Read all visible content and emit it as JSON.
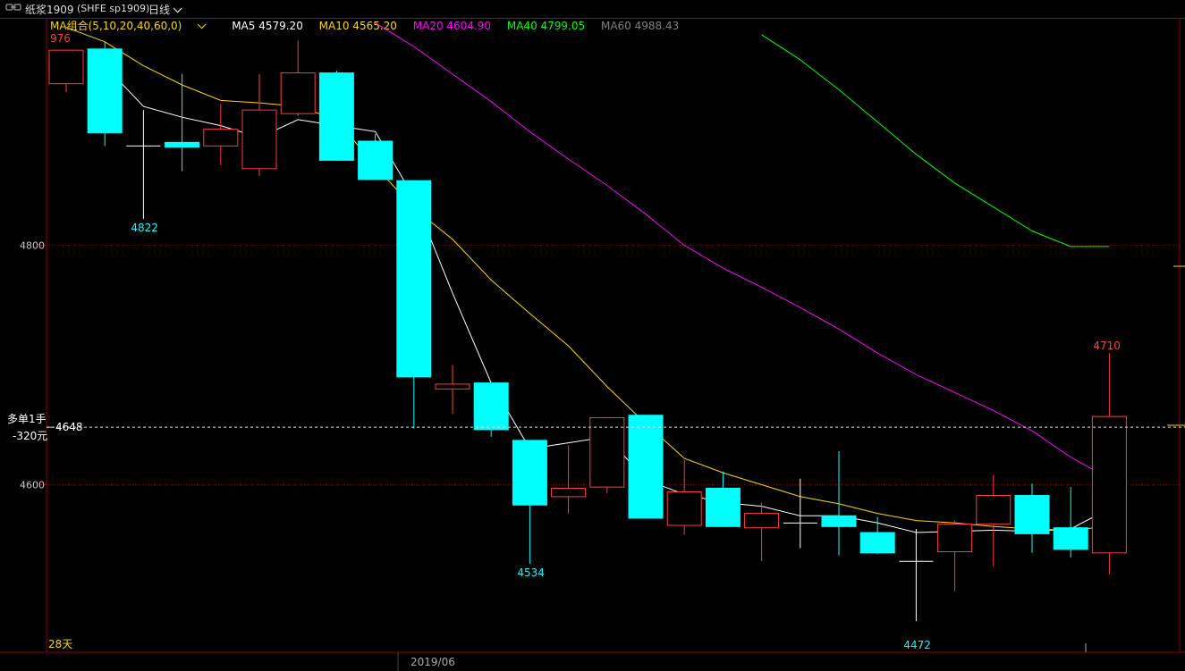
{
  "header": {
    "link_icon": "link-icon",
    "instrument": "纸浆1909",
    "code": "(SHFE sp1909)",
    "period": "日线"
  },
  "legend": {
    "group_label": "MA组合(5,10,20,40,60,0)",
    "items": [
      {
        "label": "MA5 4579.20",
        "color": "#ffffff"
      },
      {
        "label": "MA10 4565.20",
        "color": "#ffd700"
      },
      {
        "label": "MA20 4604.90",
        "color": "#ff00ff"
      },
      {
        "label": "MA40 4799.05",
        "color": "#00ff00"
      },
      {
        "label": "MA60 4988.43",
        "color": "#808080"
      }
    ]
  },
  "position": {
    "line1": "多单1手",
    "line2": "-320元",
    "price_label": "4648",
    "price": 4648
  },
  "footer": {
    "days_label": "28天",
    "date_label": "2019/06"
  },
  "colors": {
    "up": "#ff3c3c",
    "down": "#00ffff",
    "bg": "#000000",
    "grid": "#8b0000"
  },
  "chart_data": {
    "type": "candlestick",
    "ylim": [
      4460,
      4990
    ],
    "yticks": [
      4600,
      4800
    ],
    "ytick_labels": [
      "4600",
      "4800"
    ],
    "candles": [
      {
        "o": 4935,
        "h": 4960,
        "l": 4928,
        "c": 4963
      },
      {
        "o": 4964,
        "h": 4970,
        "l": 4883,
        "c": 4894
      },
      {
        "o": 4882,
        "h": 4913,
        "l": 4822,
        "c": 4883
      },
      {
        "o": 4886,
        "h": 4943,
        "l": 4862,
        "c": 4882
      },
      {
        "o": 4883,
        "h": 4918,
        "l": 4867,
        "c": 4897
      },
      {
        "o": 4864,
        "h": 4943,
        "l": 4858,
        "c": 4913
      },
      {
        "o": 4910,
        "h": 4971,
        "l": 4908,
        "c": 4944
      },
      {
        "o": 4944,
        "h": 4946,
        "l": 4873,
        "c": 4871
      },
      {
        "o": 4887,
        "h": 4893,
        "l": 4866,
        "c": 4855
      },
      {
        "o": 4854,
        "h": 4845,
        "l": 4647,
        "c": 4690
      },
      {
        "o": 4680,
        "h": 4700,
        "l": 4659,
        "c": 4684
      },
      {
        "o": 4685,
        "h": 4684,
        "l": 4640,
        "c": 4646
      },
      {
        "o": 4637,
        "h": 4632,
        "l": 4534,
        "c": 4583
      },
      {
        "o": 4590,
        "h": 4633,
        "l": 4576,
        "c": 4597
      },
      {
        "o": 4598,
        "h": 4652,
        "l": 4593,
        "c": 4656
      },
      {
        "o": 4658,
        "h": 4650,
        "l": 4585,
        "c": 4572
      },
      {
        "o": 4566,
        "h": 4621,
        "l": 4558,
        "c": 4594
      },
      {
        "o": 4597,
        "h": 4611,
        "l": 4570,
        "c": 4565
      },
      {
        "o": 4564,
        "h": 4585,
        "l": 4536,
        "c": 4576
      },
      {
        "o": 4568,
        "h": 4605,
        "l": 4547,
        "c": 4568
      },
      {
        "o": 4574,
        "h": 4628,
        "l": 4541,
        "c": 4565
      },
      {
        "o": 4560,
        "h": 4573,
        "l": 4542,
        "c": 4543
      },
      {
        "o": 4536,
        "h": 4563,
        "l": 4486,
        "c": 4536
      },
      {
        "o": 4544,
        "h": 4570,
        "l": 4511,
        "c": 4567
      },
      {
        "o": 4567,
        "h": 4608,
        "l": 4532,
        "c": 4591
      },
      {
        "o": 4591,
        "h": 4601,
        "l": 4543,
        "c": 4559
      },
      {
        "o": 4564,
        "h": 4598,
        "l": 4539,
        "c": 4546
      },
      {
        "o": 4543,
        "h": 4710,
        "l": 4525,
        "c": 4657
      }
    ],
    "ma_series": [
      {
        "name": "MA5",
        "values": [
          null,
          4950,
          4916,
          4907,
          4900,
          4890,
          4905,
          4900,
          4895,
          4840,
          4760,
          4685,
          4630,
          4635,
          4640,
          4604,
          4592,
          4585,
          4582,
          4574,
          4574,
          4568,
          4560,
          4561,
          4562,
          4561,
          4563,
          4580
        ]
      },
      {
        "name": "MA10",
        "values": [
          4982,
          4970,
          4950,
          4934,
          4921,
          4919,
          4916,
          4905,
          4866,
          4831,
          4805,
          4771,
          4743,
          4716,
          4682,
          4651,
          4622,
          4610,
          4600,
          4590,
          4584,
          4576,
          4570,
          4568,
          4565,
          4563,
          4562,
          4565
        ]
      },
      {
        "name": "MA20",
        "values": [
          null,
          null,
          null,
          null,
          null,
          null,
          null,
          null,
          4986,
          4966,
          4943,
          4920,
          4895,
          4872,
          4850,
          4826,
          4800,
          4781,
          4765,
          4748,
          4730,
          4710,
          4692,
          4677,
          4662,
          4645,
          4623,
          4605
        ]
      },
      {
        "name": "MA40",
        "values": [
          null,
          null,
          null,
          null,
          null,
          null,
          null,
          null,
          null,
          null,
          null,
          null,
          null,
          null,
          null,
          null,
          null,
          null,
          4976,
          4955,
          4930,
          4903,
          4876,
          4852,
          4832,
          4812,
          4799,
          4799
        ]
      }
    ],
    "annotations": [
      {
        "text": "976",
        "value": 4976
      },
      {
        "text": "4822",
        "value": 4822
      },
      {
        "text": "4534",
        "value": 4534
      },
      {
        "text": "4472",
        "value": 4472
      },
      {
        "text": "4710",
        "value": 4710
      }
    ]
  }
}
